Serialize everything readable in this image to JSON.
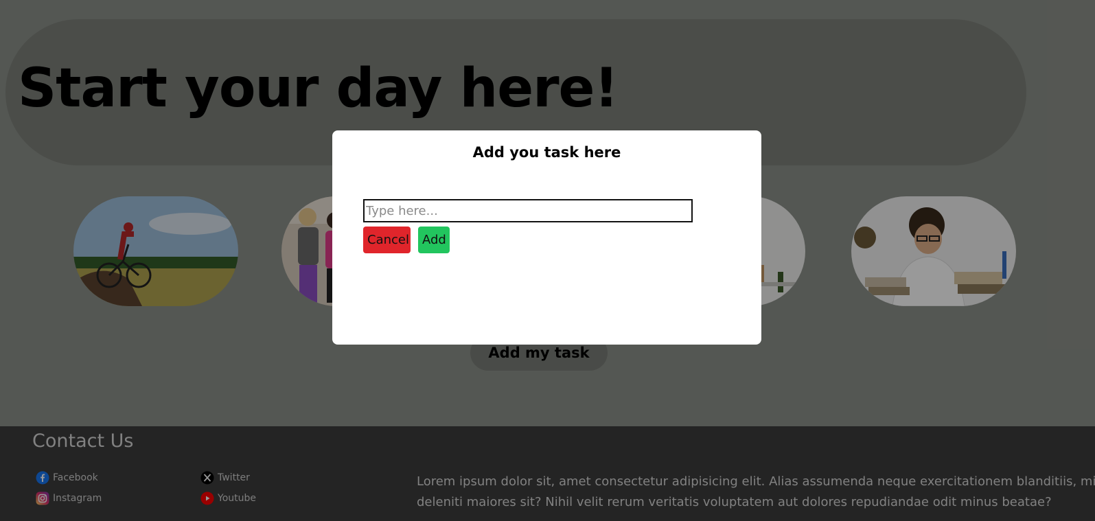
{
  "hero": {
    "title": "Start your day here!"
  },
  "activities": [
    {
      "name": "mountain-biking"
    },
    {
      "name": "fitness-class"
    },
    {
      "name": "home-office"
    },
    {
      "name": "studying"
    }
  ],
  "main": {
    "add_task_label": "Add my task"
  },
  "footer": {
    "title": "Contact Us",
    "social": [
      {
        "label": "Facebook",
        "icon": "facebook-icon"
      },
      {
        "label": "Twitter",
        "icon": "x-twitter-icon"
      },
      {
        "label": "Instagram",
        "icon": "instagram-icon"
      },
      {
        "label": "Youtube",
        "icon": "youtube-icon"
      }
    ],
    "text_line1": "Lorem ipsum dolor sit, amet consectetur adipisicing elit. Alias assumenda neque exercitationem blanditiis, minus",
    "text_line2": "deleniti maiores sit? Nihil velit rerum veritatis voluptatem aut dolores repudiandae odit minus beatae?"
  },
  "modal": {
    "title": "Add you task here",
    "input_placeholder": "Type here...",
    "input_value": "",
    "cancel_label": "Cancel",
    "add_label": "Add"
  },
  "colors": {
    "cancel": "#e0252b",
    "add": "#22c55e",
    "footer_bg": "#3c3c3c",
    "overlay": "rgba(0,0,0,0.40)"
  }
}
